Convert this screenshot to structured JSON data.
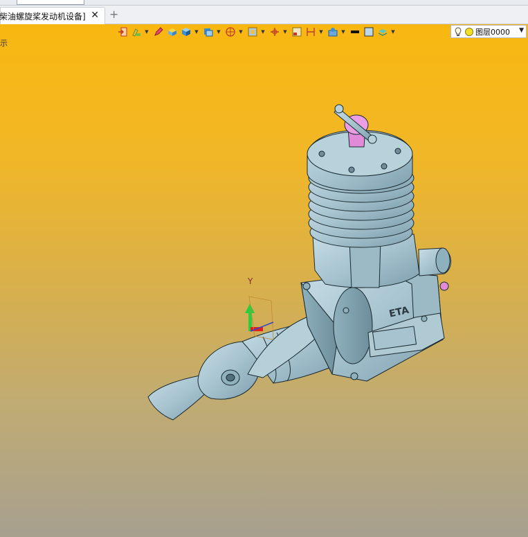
{
  "tab": {
    "title": "柴油螺旋桨发动机设备]",
    "close": "✕",
    "add": "+"
  },
  "toolbar": {
    "icons": [
      "import-icon",
      "paint-icon",
      "pencil-icon",
      "box-icon",
      "cube-icon",
      "cube-solid-icon",
      "sphere-icon",
      "box-frame-icon",
      "move-axis-icon",
      "frame-icon",
      "dimension-icon",
      "grid-icon",
      "line-color-icon",
      "fill-color-icon",
      "layer-stack-icon"
    ]
  },
  "layer": {
    "label": "图层0000",
    "arrow": "▼"
  },
  "status": {
    "text": "示"
  },
  "axis": {
    "y_label": "Y"
  },
  "engine": {
    "brand": "ETA"
  },
  "colors": {
    "body": "#a8c4cf",
    "accent": "#e08ad8",
    "axis_green": "#2ecc40",
    "axis_red": "#e02020"
  }
}
